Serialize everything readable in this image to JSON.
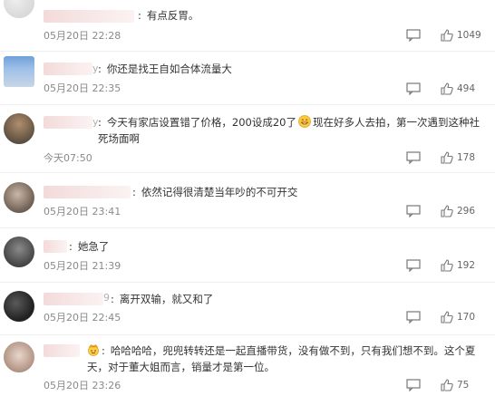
{
  "comments": [
    {
      "name_suffix": "",
      "colon": ":",
      "text": "有点反胃。",
      "time": "05月20日 22:28",
      "likes": "1049"
    },
    {
      "name_suffix": "y",
      "colon": ":",
      "text": "你还是找王自如合体流量大",
      "time": "05月20日 22:35",
      "likes": "494"
    },
    {
      "name_suffix": "y",
      "colon": ":",
      "text_before": "今天有家店设置错了价格，200设成20了",
      "text_after": "现在好多人去拍，第一次遇到这种社死场面啊",
      "time": "今天07:50",
      "likes": "178"
    },
    {
      "name_suffix": "",
      "colon": ":",
      "text": "依然记得很清楚当年吵的不可开交",
      "time": "05月20日 23:41",
      "likes": "296"
    },
    {
      "name_suffix": "",
      "colon": ":",
      "text": "她急了",
      "time": "05月20日 21:39",
      "likes": "192"
    },
    {
      "name_suffix": "9",
      "colon": ":",
      "text": "离开双输，就又和了",
      "time": "05月20日 22:45",
      "likes": "170"
    },
    {
      "name_suffix": "",
      "colon": ":",
      "text": "哈哈哈哈，兜兜转转还是一起直播带货，没有做不到，只有我们想不到。这个夏天，对于董大姐而言，销量才是第一位。",
      "time": "05月20日 23:26",
      "likes": "75"
    }
  ],
  "icons": {
    "reply": "reply-icon",
    "like": "thumbs-up-icon",
    "emoji_grin": "grin-emoji-icon",
    "emoji_crown": "crown-emoji-icon"
  }
}
